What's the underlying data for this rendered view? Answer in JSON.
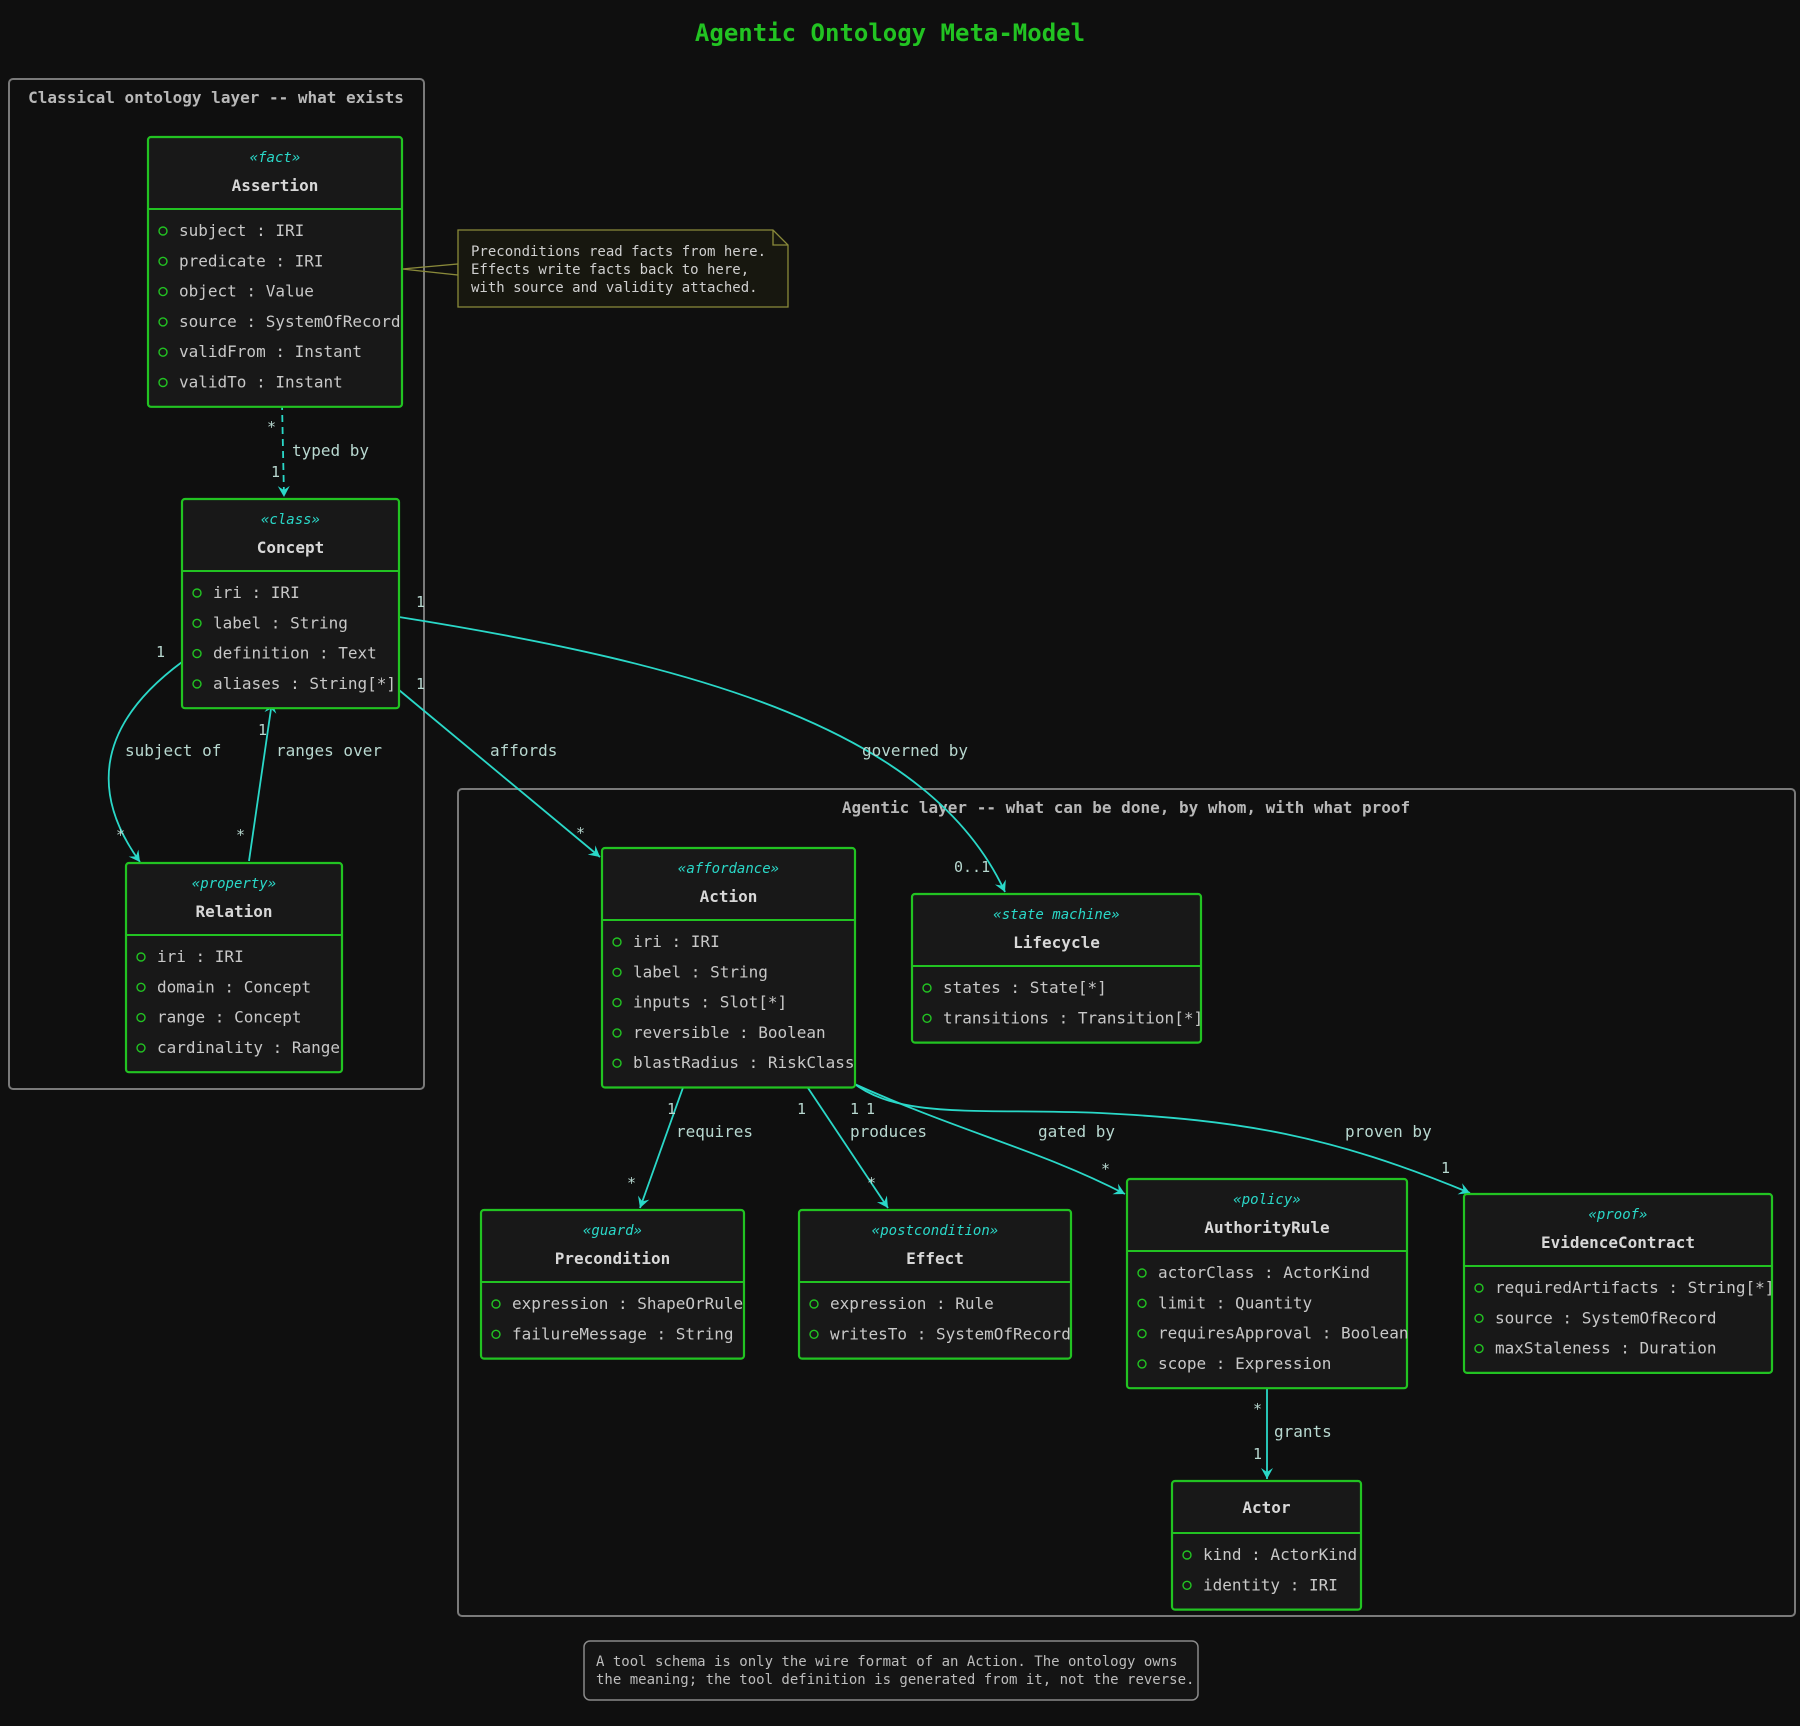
{
  "title": "Agentic Ontology Meta-Model",
  "packages": {
    "classical": "Classical ontology layer -- what exists",
    "agentic": "Agentic layer -- what can be done, by whom, with what proof"
  },
  "classes": {
    "assertion": {
      "stereotype": "«fact»",
      "name": "Assertion",
      "attributes": [
        "subject : IRI",
        "predicate : IRI",
        "object : Value",
        "source : SystemOfRecord",
        "validFrom : Instant",
        "validTo : Instant"
      ]
    },
    "concept": {
      "stereotype": "«class»",
      "name": "Concept",
      "attributes": [
        "iri : IRI",
        "label : String",
        "definition : Text",
        "aliases : String[*]"
      ]
    },
    "relation": {
      "stereotype": "«property»",
      "name": "Relation",
      "attributes": [
        "iri : IRI",
        "domain : Concept",
        "range : Concept",
        "cardinality : Range"
      ]
    },
    "action": {
      "stereotype": "«affordance»",
      "name": "Action",
      "attributes": [
        "iri : IRI",
        "label : String",
        "inputs : Slot[*]",
        "reversible : Boolean",
        "blastRadius : RiskClass"
      ]
    },
    "lifecycle": {
      "stereotype": "«state machine»",
      "name": "Lifecycle",
      "attributes": [
        "states : State[*]",
        "transitions : Transition[*]"
      ]
    },
    "precondition": {
      "stereotype": "«guard»",
      "name": "Precondition",
      "attributes": [
        "expression : ShapeOrRule",
        "failureMessage : String"
      ]
    },
    "effect": {
      "stereotype": "«postcondition»",
      "name": "Effect",
      "attributes": [
        "expression : Rule",
        "writesTo : SystemOfRecord"
      ]
    },
    "authority": {
      "stereotype": "«policy»",
      "name": "AuthorityRule",
      "attributes": [
        "actorClass : ActorKind",
        "limit : Quantity",
        "requiresApproval : Boolean",
        "scope : Expression"
      ]
    },
    "evidence": {
      "stereotype": "«proof»",
      "name": "EvidenceContract",
      "attributes": [
        "requiredArtifacts : String[*]",
        "source : SystemOfRecord",
        "maxStaleness : Duration"
      ]
    },
    "actor": {
      "stereotype": "",
      "name": "Actor",
      "attributes": [
        "kind : ActorKind",
        "identity : IRI"
      ]
    }
  },
  "edges": [
    {
      "id": "typed-by",
      "label": "typed by",
      "from_mult": "*",
      "to_mult": "1"
    },
    {
      "id": "subject-of",
      "label": "subject of",
      "from_mult": "1",
      "to_mult": "*"
    },
    {
      "id": "ranges-over",
      "label": "ranges over",
      "from_mult": "*",
      "to_mult": "1"
    },
    {
      "id": "affords",
      "label": "affords",
      "from_mult": "1",
      "to_mult": "*"
    },
    {
      "id": "governed-by",
      "label": "governed by",
      "from_mult": "1",
      "to_mult": "0..1"
    },
    {
      "id": "requires",
      "label": "requires",
      "from_mult": "1",
      "to_mult": "*"
    },
    {
      "id": "produces",
      "label": "produces",
      "from_mult": "1",
      "to_mult": "*"
    },
    {
      "id": "gated-by",
      "label": "gated by",
      "from_mult": "1",
      "to_mult": "*"
    },
    {
      "id": "proven-by",
      "label": "proven by",
      "from_mult": "1",
      "to_mult": "1"
    },
    {
      "id": "grants",
      "label": "grants",
      "from_mult": "*",
      "to_mult": "1"
    }
  ],
  "note": {
    "lines": [
      "Preconditions read facts from here.",
      "Effects write facts back to here,",
      "with source and validity attached."
    ]
  },
  "footer": {
    "lines": [
      "A tool schema is only the wire format of an Action. The ontology owns",
      "the meaning; the tool definition is generated from it, not the reverse."
    ]
  }
}
